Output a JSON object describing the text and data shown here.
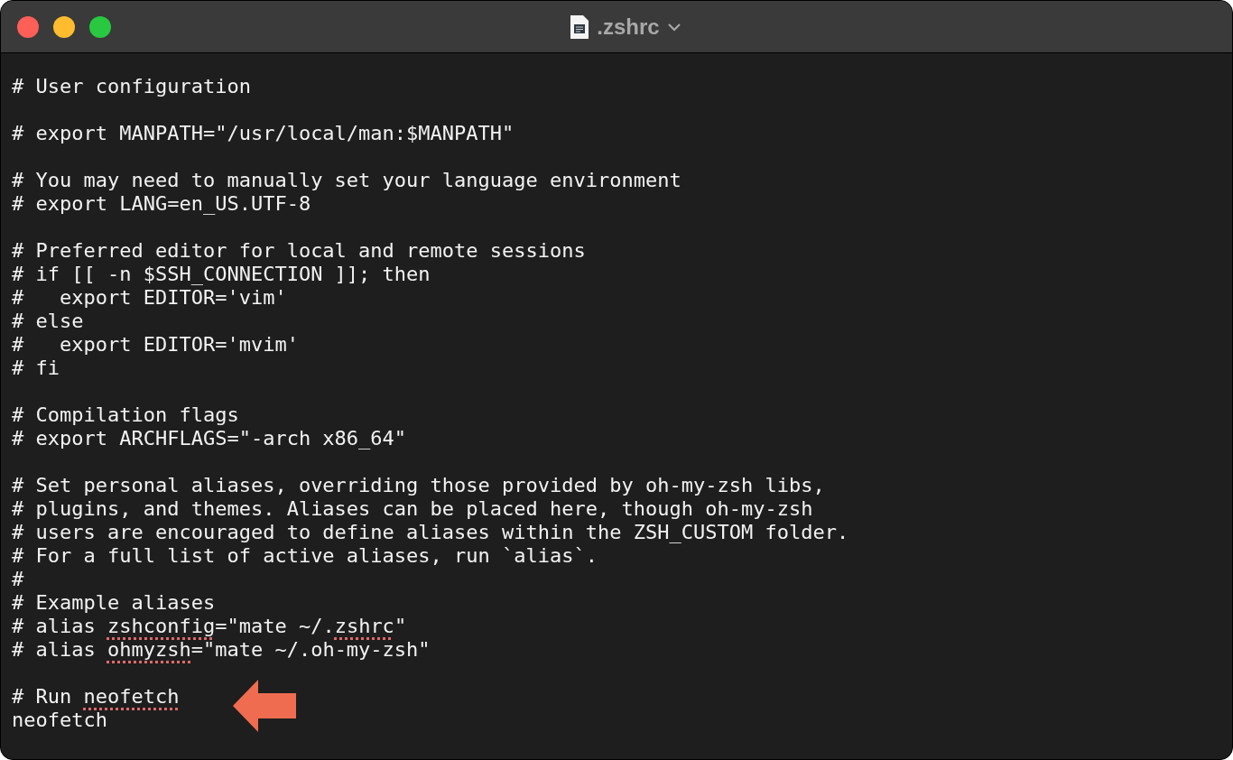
{
  "window": {
    "title": ".zshrc"
  },
  "editor": {
    "lines": [
      {
        "kind": "text",
        "segments": [
          {
            "text": "# User configuration",
            "misspelled": false
          }
        ]
      },
      {
        "kind": "blank"
      },
      {
        "kind": "text",
        "segments": [
          {
            "text": "# export MANPATH=\"/usr/local/man:$MANPATH\"",
            "misspelled": false
          }
        ]
      },
      {
        "kind": "blank"
      },
      {
        "kind": "text",
        "segments": [
          {
            "text": "# You may need to manually set your language environment",
            "misspelled": false
          }
        ]
      },
      {
        "kind": "text",
        "segments": [
          {
            "text": "# export LANG=en_US.UTF-8",
            "misspelled": false
          }
        ]
      },
      {
        "kind": "blank"
      },
      {
        "kind": "text",
        "segments": [
          {
            "text": "# Preferred editor for local and remote sessions",
            "misspelled": false
          }
        ]
      },
      {
        "kind": "text",
        "segments": [
          {
            "text": "# if [[ -n $SSH_CONNECTION ]]; then",
            "misspelled": false
          }
        ]
      },
      {
        "kind": "text",
        "segments": [
          {
            "text": "#   export EDITOR='vim'",
            "misspelled": false
          }
        ]
      },
      {
        "kind": "text",
        "segments": [
          {
            "text": "# else",
            "misspelled": false
          }
        ]
      },
      {
        "kind": "text",
        "segments": [
          {
            "text": "#   export EDITOR='mvim'",
            "misspelled": false
          }
        ]
      },
      {
        "kind": "text",
        "segments": [
          {
            "text": "# fi",
            "misspelled": false
          }
        ]
      },
      {
        "kind": "blank"
      },
      {
        "kind": "text",
        "segments": [
          {
            "text": "# Compilation flags",
            "misspelled": false
          }
        ]
      },
      {
        "kind": "text",
        "segments": [
          {
            "text": "# export ARCHFLAGS=\"-arch x86_64\"",
            "misspelled": false
          }
        ]
      },
      {
        "kind": "blank"
      },
      {
        "kind": "text",
        "segments": [
          {
            "text": "# Set personal aliases, overriding those provided by oh-my-zsh libs,",
            "misspelled": false
          }
        ]
      },
      {
        "kind": "text",
        "segments": [
          {
            "text": "# plugins, and themes. Aliases can be placed here, though oh-my-zsh",
            "misspelled": false
          }
        ]
      },
      {
        "kind": "text",
        "segments": [
          {
            "text": "# users are encouraged to define aliases within the ZSH_CUSTOM folder.",
            "misspelled": false
          }
        ]
      },
      {
        "kind": "text",
        "segments": [
          {
            "text": "# For a full list of active aliases, run `alias`.",
            "misspelled": false
          }
        ]
      },
      {
        "kind": "text",
        "segments": [
          {
            "text": "#",
            "misspelled": false
          }
        ]
      },
      {
        "kind": "text",
        "segments": [
          {
            "text": "# Example aliases",
            "misspelled": false
          }
        ]
      },
      {
        "kind": "text",
        "segments": [
          {
            "text": "# alias ",
            "misspelled": false
          },
          {
            "text": "zshconfig",
            "misspelled": true
          },
          {
            "text": "=\"mate ~/.",
            "misspelled": false
          },
          {
            "text": "zshrc",
            "misspelled": true
          },
          {
            "text": "\"",
            "misspelled": false
          }
        ]
      },
      {
        "kind": "text",
        "segments": [
          {
            "text": "# alias ",
            "misspelled": false
          },
          {
            "text": "ohmyzsh",
            "misspelled": true
          },
          {
            "text": "=\"mate ~/.oh-my-zsh\"",
            "misspelled": false
          }
        ]
      },
      {
        "kind": "blank"
      },
      {
        "kind": "text",
        "segments": [
          {
            "text": "# Run ",
            "misspelled": false
          },
          {
            "text": "neofetch",
            "misspelled": true
          }
        ]
      },
      {
        "kind": "text",
        "segments": [
          {
            "text": "neofetch",
            "misspelled": false
          }
        ]
      }
    ]
  }
}
